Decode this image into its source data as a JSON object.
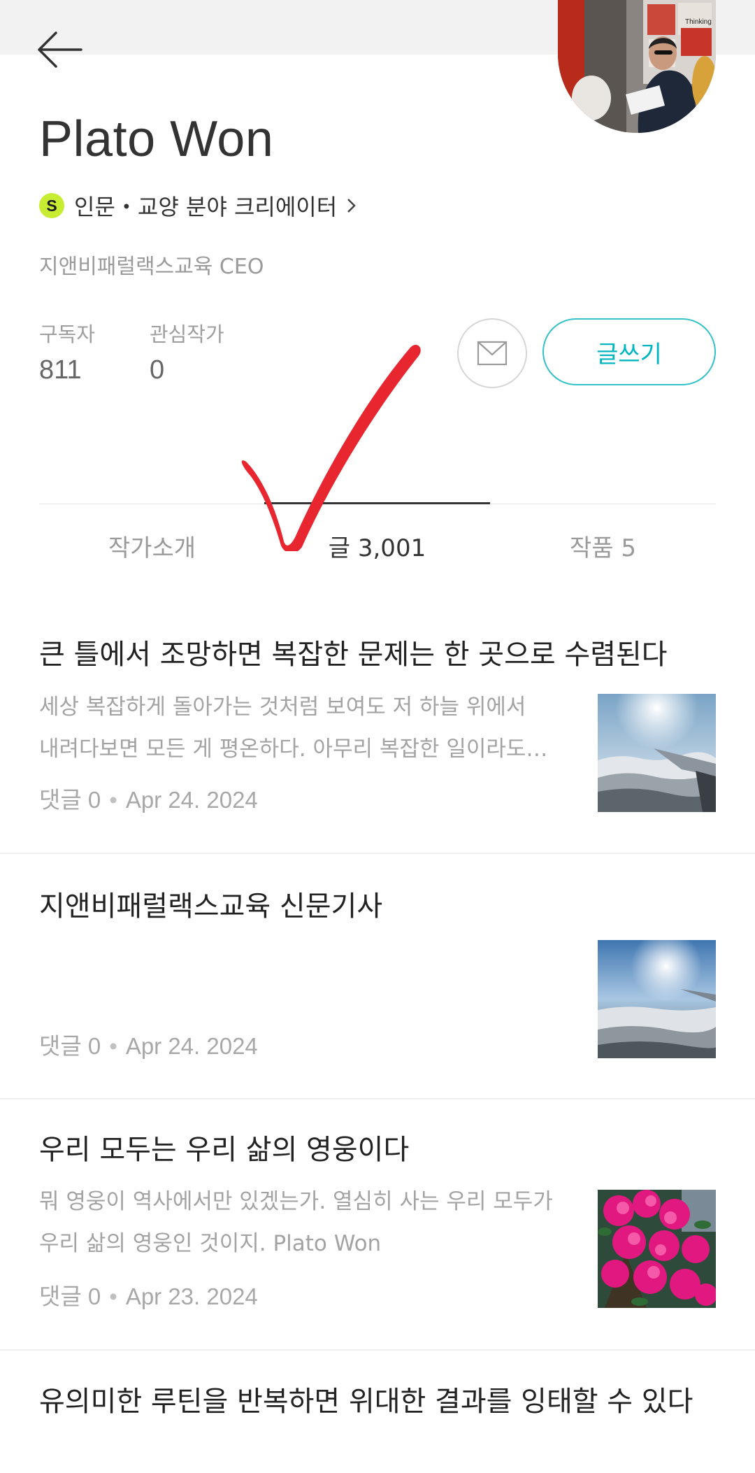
{
  "profile": {
    "name": "Plato Won",
    "creator_badge": "S",
    "creator_category": "인문・교양 분야 크리에이터",
    "bio": "지앤비패럴랙스교육 CEO",
    "subscribers_label": "구독자",
    "subscribers_value": "811",
    "following_label": "관심작가",
    "following_value": "0",
    "write_button": "글쓰기",
    "avatar_sign_text": "Thinking"
  },
  "tabs": [
    {
      "label": "작가소개",
      "active": false
    },
    {
      "label": "글 3,001",
      "active": true
    },
    {
      "label": "작품 5",
      "active": false
    }
  ],
  "posts": [
    {
      "title": "큰 틀에서 조망하면 복잡한 문제는 한 곳으로 수렴된다",
      "snippet_1": "세상 복잡하게 돌아가는 것처럼 보여도 저 하늘 위에서",
      "snippet_2": "내려다보면 모든 게 평온하다.  아무리 복잡한 일이라도…",
      "comments": "댓글 0",
      "date": "Apr 24. 2024",
      "thumb": "sky-clouds-wing"
    },
    {
      "title": "지앤비패럴랙스교육 신문기사",
      "snippet_1": "",
      "snippet_2": "",
      "comments": "댓글 0",
      "date": "Apr 24. 2024",
      "thumb": "sky-clouds-sun"
    },
    {
      "title": "우리 모두는 우리 삶의 영웅이다",
      "snippet_1": "뭐 영웅이 역사에서만 있겠는가. 열심히 사는 우리 모두가",
      "snippet_2": "우리 삶의 영웅인 것이지. Plato Won",
      "comments": "댓글 0",
      "date": "Apr 23. 2024",
      "thumb": "pink-azaleas"
    },
    {
      "title": "유의미한 루틴을 반복하면 위대한 결과를 잉태할 수 있다"
    }
  ],
  "meta_separator": "•",
  "colors": {
    "accent": "#00b6c0",
    "badge": "#c7ec32",
    "check_annotation": "#e8262f"
  }
}
